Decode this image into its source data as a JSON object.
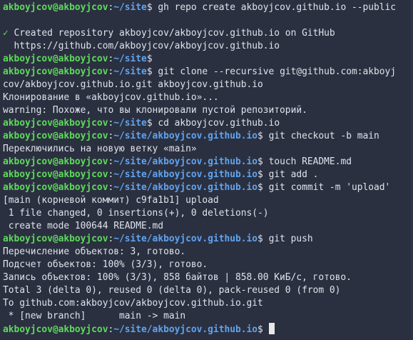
{
  "terminal": {
    "prompt_user": "akboyjcov@akboyjcov",
    "prompt_colon": ":",
    "prompt_dollar": "$ ",
    "cwd_site": "~/site",
    "cwd_repo": "~/site/akboyjcov.github.io",
    "lines": [
      {
        "kind": "prompt",
        "cwd": "~/site",
        "cmd": "gh repo create akboyjcov.github.io --public"
      },
      {
        "kind": "blank"
      },
      {
        "kind": "check",
        "mark": "✓",
        "text": " Created repository akboyjcov/akboyjcov.github.io on GitHub"
      },
      {
        "kind": "out",
        "text": "  https://github.com/akboyjcov/akboyjcov.github.io"
      },
      {
        "kind": "prompt",
        "cwd": "~/site",
        "cmd": ""
      },
      {
        "kind": "prompt",
        "cwd": "~/site",
        "cmd": "git clone --recursive git@github.com:akboyj"
      },
      {
        "kind": "out",
        "text": "cov/akboyjcov.github.io.git akboyjcov.github.io"
      },
      {
        "kind": "out",
        "text": "Клонирование в «akboyjcov.github.io»..."
      },
      {
        "kind": "out",
        "text": "warning: Похоже, что вы клонировали пустой репозиторий."
      },
      {
        "kind": "prompt",
        "cwd": "~/site",
        "cmd": "cd akboyjcov.github.io"
      },
      {
        "kind": "prompt",
        "cwd": "~/site/akboyjcov.github.io",
        "cmd": "git checkout -b main"
      },
      {
        "kind": "out",
        "text": "Переключились на новую ветку «main»"
      },
      {
        "kind": "prompt",
        "cwd": "~/site/akboyjcov.github.io",
        "cmd": "touch README.md"
      },
      {
        "kind": "prompt",
        "cwd": "~/site/akboyjcov.github.io",
        "cmd": "git add ."
      },
      {
        "kind": "prompt",
        "cwd": "~/site/akboyjcov.github.io",
        "cmd": "git commit -m 'upload'"
      },
      {
        "kind": "out",
        "text": "[main (корневой коммит) c9fa1b1] upload"
      },
      {
        "kind": "out",
        "text": " 1 file changed, 0 insertions(+), 0 deletions(-)"
      },
      {
        "kind": "out",
        "text": " create mode 100644 README.md"
      },
      {
        "kind": "prompt",
        "cwd": "~/site/akboyjcov.github.io",
        "cmd": "git push"
      },
      {
        "kind": "out",
        "text": "Перечисление объектов: 3, готово."
      },
      {
        "kind": "out",
        "text": "Подсчет объектов: 100% (3/3), готово."
      },
      {
        "kind": "out",
        "text": "Запись объектов: 100% (3/3), 858 байтов | 858.00 КиБ/с, готово."
      },
      {
        "kind": "out",
        "text": "Total 3 (delta 0), reused 0 (delta 0), pack-reused 0 (from 0)"
      },
      {
        "kind": "out",
        "text": "To github.com:akboyjcov/akboyjcov.github.io.git"
      },
      {
        "kind": "out",
        "text": " * [new branch]      main -> main"
      },
      {
        "kind": "prompt",
        "cwd": "~/site/akboyjcov.github.io",
        "cmd": "",
        "cursor": true
      }
    ]
  },
  "colors": {
    "background": "#2b3040",
    "user": "#5ddb5b",
    "path": "#5fa4f0",
    "text": "#dfe3ec"
  }
}
